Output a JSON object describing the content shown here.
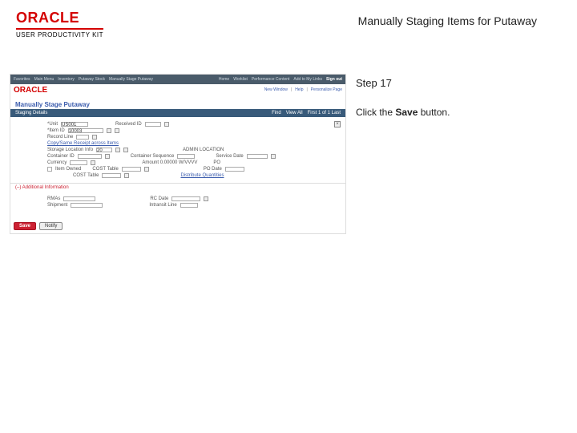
{
  "header": {
    "brand": "ORACLE",
    "brand_sub": "USER PRODUCTIVITY KIT",
    "title": "Manually Staging Items for Putaway"
  },
  "instructions": {
    "step_label": "Step 17",
    "step_prefix": "Click the ",
    "step_strong": "Save",
    "step_suffix": " button."
  },
  "screenshot": {
    "breadcrumb_left": [
      "Favorites",
      "Main Menu",
      "Inventory",
      "Putaway Stock",
      "Manually Stage Putaway"
    ],
    "breadcrumb_right": [
      "Home",
      "Worklist",
      "Performance Content",
      "Add to My Links"
    ],
    "signout": "Sign out",
    "ss_brand": "ORACLE",
    "ss_links": [
      "New Window",
      "Help",
      "Personalize Page"
    ],
    "page_heading": "Manually Stage Putaway",
    "details_title": "Staging Details",
    "details_right": [
      "Find",
      "View All",
      "First  1 of 1  Last"
    ],
    "r1_lbl1": "*Unit",
    "r1_val1": "US001",
    "r1_lbl2": "Received ID",
    "r1_val2": "",
    "r2_lbl1": "*Item ID",
    "r2_val1": "10003",
    "r3_lbl": "Record Line",
    "r4_link": "Copy/Same Receipt across Items",
    "r5_lbl": "Storage Location Info",
    "r5_val": "20",
    "r5_sub": "ADMIN LOCATION",
    "r6_lbl1": "Container ID",
    "r6_lbl2": "Container Sequence",
    "r6_lbl3": "Service Date",
    "r7_lbl1": "Currency",
    "r7_lbl2": "Amount  0.00000   W/VVVV",
    "r7_lbl3": "PO",
    "r8_chk": "Item Owned",
    "r8_lbl1": "COST Table",
    "r8_lbl2": "PO Date",
    "r9_lbl": "COST Table",
    "r9_sub": "Distribute Quantities",
    "addl_title": "(–) Additional Information",
    "b1_lbl1": "RMAs",
    "b1_lbl2": "RC Date",
    "b2_lbl1": "Shipment",
    "b2_lbl2": "Intransit Line",
    "save_label": "Save",
    "notify_label": "Notify",
    "close_x": "×"
  }
}
